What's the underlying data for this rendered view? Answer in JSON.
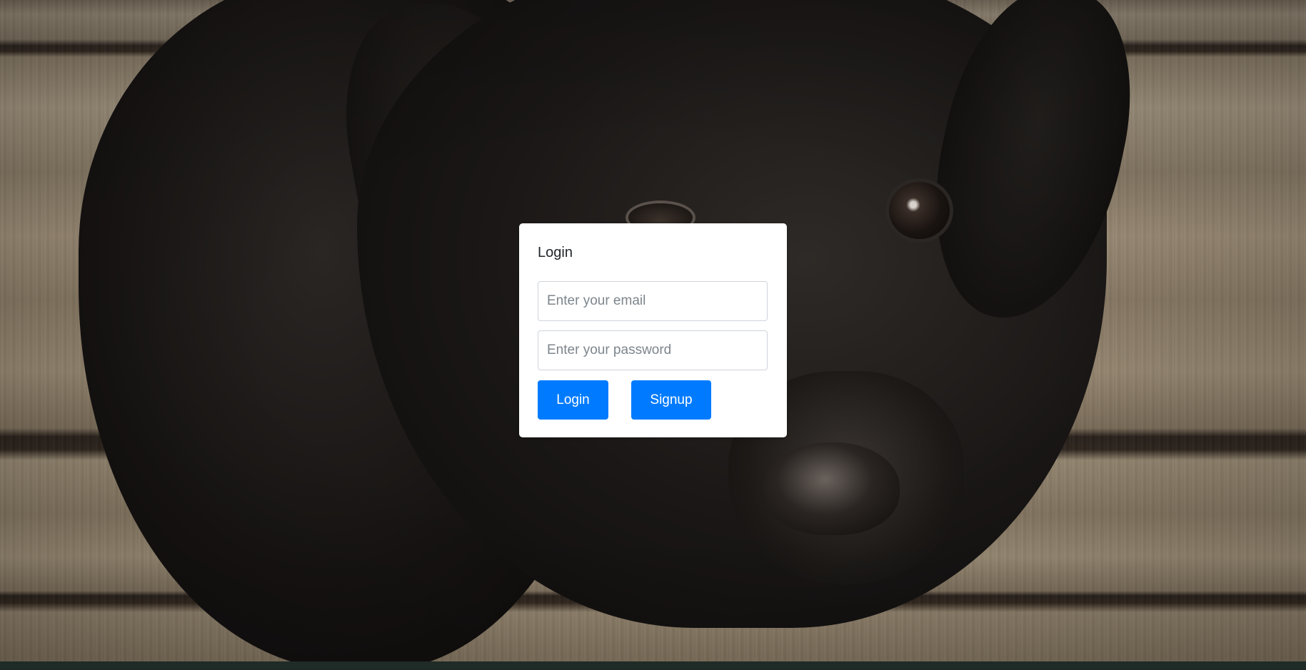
{
  "background": {
    "description_icon": "dog-photo-background"
  },
  "login_card": {
    "title": "Login",
    "email": {
      "placeholder": "Enter your email",
      "value": ""
    },
    "password": {
      "placeholder": "Enter your password",
      "value": ""
    },
    "login_label": "Login",
    "signup_label": "Signup"
  },
  "colors": {
    "primary_button": "#007bff",
    "card_background": "#ffffff",
    "input_border": "#ced4da"
  }
}
